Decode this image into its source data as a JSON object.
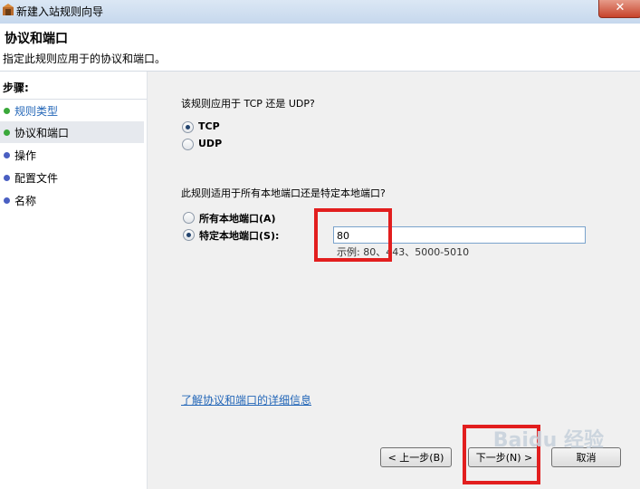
{
  "window": {
    "title": "新建入站规则向导",
    "close_label": "✕"
  },
  "header": {
    "title": "协议和端口",
    "subtitle": "指定此规则应用于的协议和端口。"
  },
  "sidebar": {
    "heading": "步骤:",
    "items": [
      {
        "label": "规则类型",
        "state": "done",
        "color": "#3aa83a"
      },
      {
        "label": "协议和端口",
        "state": "current",
        "color": "#3aa83a"
      },
      {
        "label": "操作",
        "state": "pending",
        "color": "#4a5fc2"
      },
      {
        "label": "配置文件",
        "state": "pending",
        "color": "#4a5fc2"
      },
      {
        "label": "名称",
        "state": "pending",
        "color": "#4a5fc2"
      }
    ]
  },
  "protocol": {
    "question": "该规则应用于 TCP 还是 UDP?",
    "options": [
      {
        "label": "TCP",
        "checked": true
      },
      {
        "label": "UDP",
        "checked": false
      }
    ]
  },
  "ports": {
    "question": "此规则适用于所有本地端口还是特定本地端口?",
    "options": [
      {
        "label": "所有本地端口(A)",
        "checked": false
      },
      {
        "label": "特定本地端口(S):",
        "checked": true
      }
    ],
    "value": "80",
    "example": "示例: 80、443、5000-5010"
  },
  "help_link": "了解协议和端口的详细信息",
  "buttons": {
    "back": "< 上一步(B)",
    "next": "下一步(N) >",
    "cancel": "取消"
  },
  "watermark": "Baidu 经验"
}
